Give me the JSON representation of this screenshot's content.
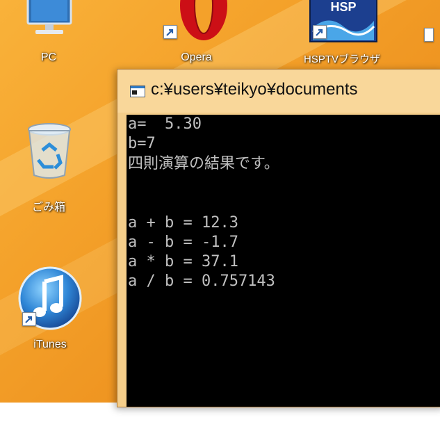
{
  "desktop": {
    "icons": [
      {
        "label": "PC",
        "icon": "computer-icon"
      },
      {
        "label": "Opera",
        "icon": "opera-icon"
      },
      {
        "label": "HSPTVブラウザ",
        "icon": "hsptv-icon"
      },
      {
        "label": "ごみ箱",
        "icon": "recycle-bin-icon"
      },
      {
        "label": "iTunes",
        "icon": "itunes-icon"
      }
    ],
    "hsp_logo_text": "HSP"
  },
  "console": {
    "title": "c:¥users¥teikyo¥documents",
    "lines": [
      "a=  5.30",
      "b=7",
      "四則演算の結果です。",
      "",
      "a + b = 12.3",
      "a - b = -1.7",
      "a * b = 37.1",
      "a / b = 0.757143"
    ]
  },
  "colors": {
    "desktop_background": "#f4a12a",
    "console_background": "#000000",
    "console_text": "#c0c0c0"
  }
}
